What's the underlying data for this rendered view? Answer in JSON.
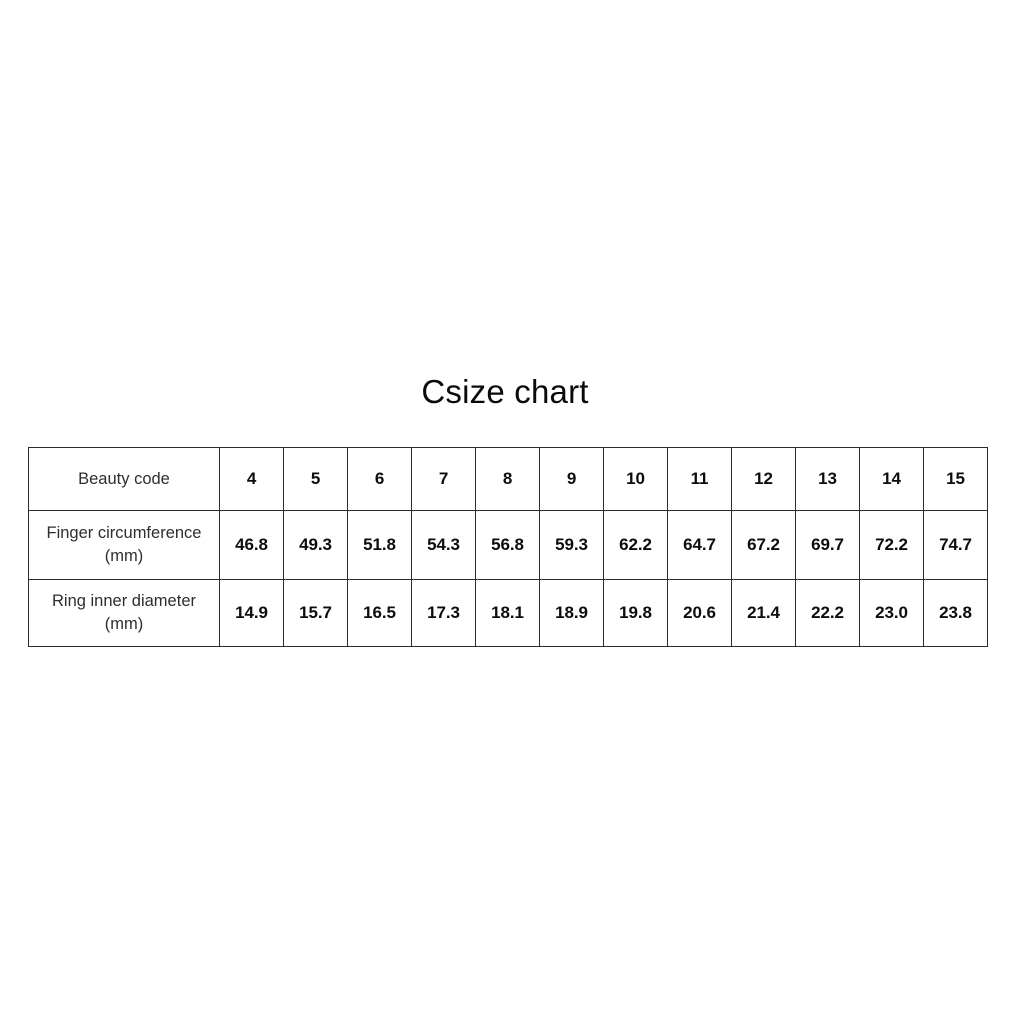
{
  "title": "Csize chart",
  "chart_data": {
    "type": "table",
    "title": "Csize chart",
    "orientation": "rows-as-series",
    "row_header_label": "Beauty code",
    "categories": [
      "4",
      "5",
      "6",
      "7",
      "8",
      "9",
      "10",
      "11",
      "12",
      "13",
      "14",
      "15"
    ],
    "series": [
      {
        "name": "Finger circumference (mm)",
        "unit": "mm",
        "values": [
          "46.8",
          "49.3",
          "51.8",
          "54.3",
          "56.8",
          "59.3",
          "62.2",
          "64.7",
          "67.2",
          "69.7",
          "72.2",
          "74.7"
        ]
      },
      {
        "name": "Ring inner diameter (mm)",
        "unit": "mm",
        "values": [
          "14.9",
          "15.7",
          "16.5",
          "17.3",
          "18.1",
          "18.9",
          "19.8",
          "20.6",
          "21.4",
          "22.2",
          "23.0",
          "23.8"
        ]
      }
    ]
  },
  "table": {
    "rows": [
      {
        "id": "beauty-code",
        "label": "Beauty code",
        "label_unit": "",
        "values": [
          "4",
          "5",
          "6",
          "7",
          "8",
          "9",
          "10",
          "11",
          "12",
          "13",
          "14",
          "15"
        ]
      },
      {
        "id": "finger-circumference",
        "label": "Finger circumference",
        "label_unit": "(mm)",
        "values": [
          "46.8",
          "49.3",
          "51.8",
          "54.3",
          "56.8",
          "59.3",
          "62.2",
          "64.7",
          "67.2",
          "69.7",
          "72.2",
          "74.7"
        ]
      },
      {
        "id": "ring-inner-diameter",
        "label": "Ring inner diameter",
        "label_unit": "(mm)",
        "values": [
          "14.9",
          "15.7",
          "16.5",
          "17.3",
          "18.1",
          "18.9",
          "19.8",
          "20.6",
          "21.4",
          "22.2",
          "23.0",
          "23.8"
        ]
      }
    ]
  },
  "colors": {
    "background": "#ffffff",
    "border": "#2b2b2b",
    "title_text": "#0a0a0a",
    "label_text": "#2e2e2e",
    "value_text": "#0d0d0d"
  }
}
